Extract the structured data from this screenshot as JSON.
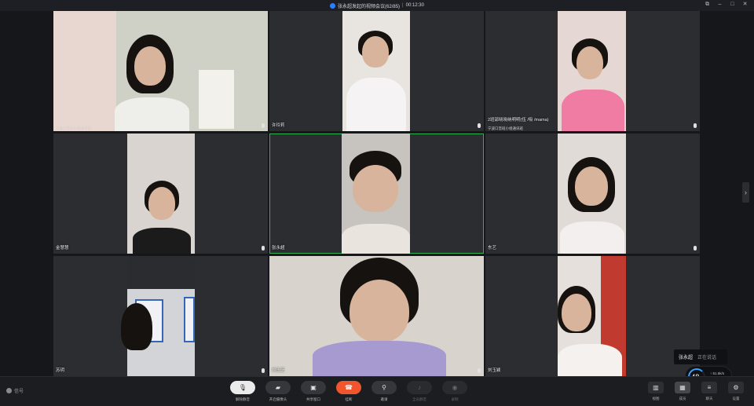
{
  "titlebar": {
    "meeting_title": "张永超发起的视频会议(62/85)",
    "duration": "00:12:30"
  },
  "tiles": [
    {
      "name": "",
      "sub": "宁波口音班小组通讯班",
      "bg": "#cfd0c6"
    },
    {
      "name": "许玲莉",
      "sub": "",
      "bg": "#e8e4df"
    },
    {
      "name": "2班邵晓晓纳明明(伍 /吸 /mama)",
      "sub": "宁波口音班小组通讯班",
      "bg": "#e5d8d4"
    },
    {
      "name": "金慧慧",
      "sub": "",
      "bg": "#d9d4cf"
    },
    {
      "name": "张永超",
      "sub": "",
      "bg": "#c7c4bf"
    },
    {
      "name": "东艺",
      "sub": "",
      "bg": "#e1dbd7"
    },
    {
      "name": "苏玥",
      "sub": "",
      "bg": "#d2d4d8"
    },
    {
      "name": "刘玉芝",
      "sub": "",
      "bg": "#d8d3cc"
    },
    {
      "name": "刘玉颖",
      "sub": "",
      "bg": "#e6e0dc"
    }
  ],
  "toolbar": {
    "signal_label": "信号",
    "controls": [
      {
        "label": "解除静音",
        "icon": "mic-muted-icon",
        "glyph": "🎙",
        "state": "muted"
      },
      {
        "label": "开启摄像头",
        "icon": "camera-icon",
        "glyph": "▰",
        "state": "normal"
      },
      {
        "label": "共享窗口",
        "icon": "screen-share-icon",
        "glyph": "▣",
        "state": "normal"
      },
      {
        "label": "挂断",
        "icon": "hang-up-icon",
        "glyph": "☎",
        "state": "danger"
      },
      {
        "label": "邀请",
        "icon": "invite-icon",
        "glyph": "⚲",
        "state": "normal"
      },
      {
        "label": "全员静音",
        "icon": "mute-all-icon",
        "glyph": "♪",
        "state": "disabled"
      },
      {
        "label": "录制",
        "icon": "record-icon",
        "glyph": "◉",
        "state": "disabled"
      }
    ],
    "right_controls": [
      {
        "label": "视图",
        "icon": "layout-icon",
        "glyph": "▥"
      },
      {
        "label": "成员",
        "icon": "members-icon",
        "glyph": "▦"
      },
      {
        "label": "聊天",
        "icon": "chat-icon",
        "glyph": "≡"
      },
      {
        "label": "设置",
        "icon": "settings-icon",
        "glyph": "⚙"
      }
    ]
  },
  "speaking": {
    "name": "张永超",
    "status": "正在说话"
  },
  "network": {
    "value": "48",
    "unit": "%",
    "up": "51.5k/s",
    "down": "552k/s"
  },
  "colors": {
    "accent": "#2d7ff9",
    "active_border": "#2fb451",
    "hangup": "#f0552d"
  }
}
